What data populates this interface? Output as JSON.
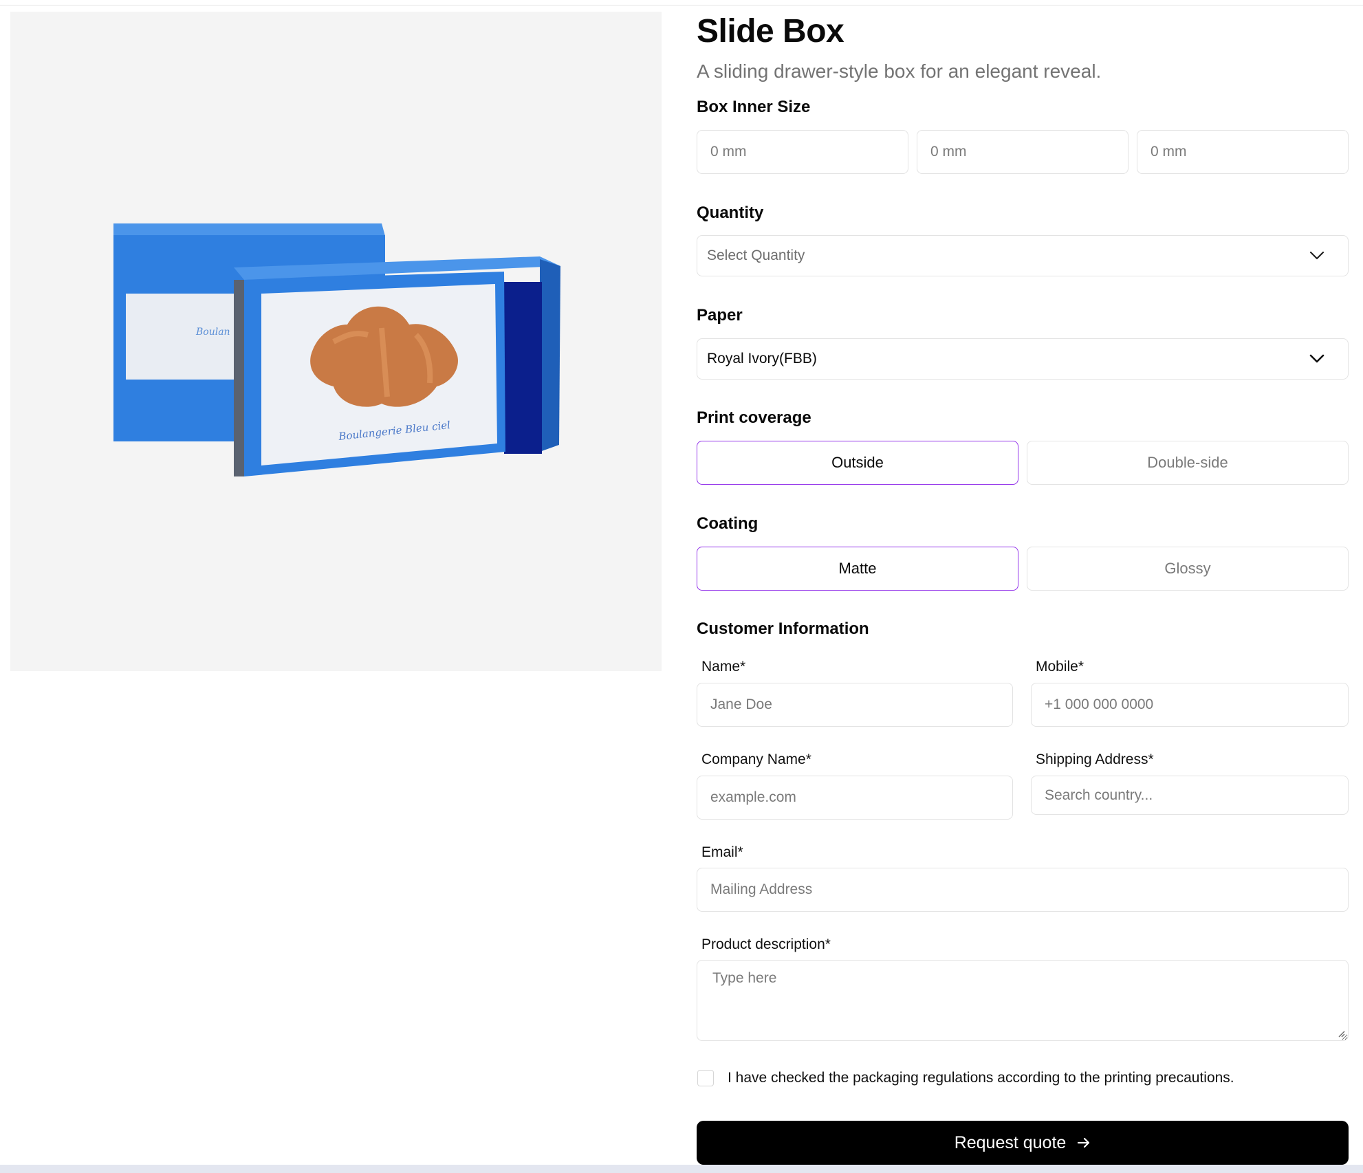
{
  "product": {
    "title": "Slide Box",
    "subtitle": "A sliding drawer-style box for an elegant reveal.",
    "image_brand_text": "Boulangerie Bleu ciel"
  },
  "size": {
    "label": "Box Inner Size",
    "fields": [
      {
        "placeholder": "0 mm"
      },
      {
        "placeholder": "0 mm"
      },
      {
        "placeholder": "0 mm"
      }
    ]
  },
  "quantity": {
    "label": "Quantity",
    "selected": "Select Quantity"
  },
  "paper": {
    "label": "Paper",
    "selected": "Royal Ivory(FBB)"
  },
  "print_coverage": {
    "label": "Print coverage",
    "options": [
      "Outside",
      "Double-side"
    ],
    "selected": "Outside"
  },
  "coating": {
    "label": "Coating",
    "options": [
      "Matte",
      "Glossy"
    ],
    "selected": "Matte"
  },
  "customer": {
    "heading": "Customer Information",
    "name": {
      "label": "Name*",
      "placeholder": "Jane Doe"
    },
    "mobile": {
      "label": "Mobile*",
      "placeholder": "+1 000 000 0000"
    },
    "company": {
      "label": "Company Name*",
      "placeholder": "example.com"
    },
    "shipping": {
      "label": "Shipping Address*",
      "placeholder": "Search country..."
    },
    "email": {
      "label": "Email*",
      "placeholder": "Mailing Address"
    },
    "description": {
      "label": "Product description*",
      "placeholder": "Type here"
    }
  },
  "agreement": {
    "text": "I have checked the packaging regulations according to the printing precautions.",
    "checked": false
  },
  "submit": {
    "label": "Request quote"
  },
  "colors": {
    "accent_border": "#9333ea",
    "box_blue": "#2f7fe0",
    "button_bg": "#000000"
  }
}
